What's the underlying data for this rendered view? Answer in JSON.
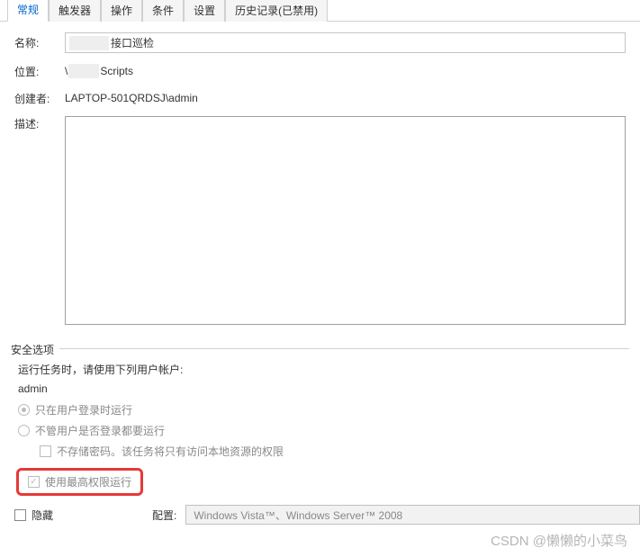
{
  "tabs": {
    "general": "常规",
    "triggers": "触发器",
    "actions": "操作",
    "conditions": "条件",
    "settings": "设置",
    "history": "历史记录(已禁用)"
  },
  "form": {
    "name_label": "名称:",
    "name_suffix": "接口巡检",
    "location_label": "位置:",
    "location_prefix": "\\",
    "location_suffix": "Scripts",
    "author_label": "创建者:",
    "author_value": "LAPTOP-501QRDSJ\\admin",
    "description_label": "描述:"
  },
  "security": {
    "legend": "安全选项",
    "prompt": "运行任务时，请使用下列用户帐户:",
    "account": "admin",
    "radio_logged_on": "只在用户登录时运行",
    "radio_any": "不管用户是否登录都要运行",
    "check_no_password": "不存储密码。该任务将只有访问本地资源的权限",
    "check_highest": "使用最高权限运行"
  },
  "bottom": {
    "hidden_label": "隐藏",
    "config_label": "配置:",
    "config_value": "Windows Vista™、Windows Server™ 2008"
  },
  "watermark": "CSDN @懒懒的小菜鸟"
}
